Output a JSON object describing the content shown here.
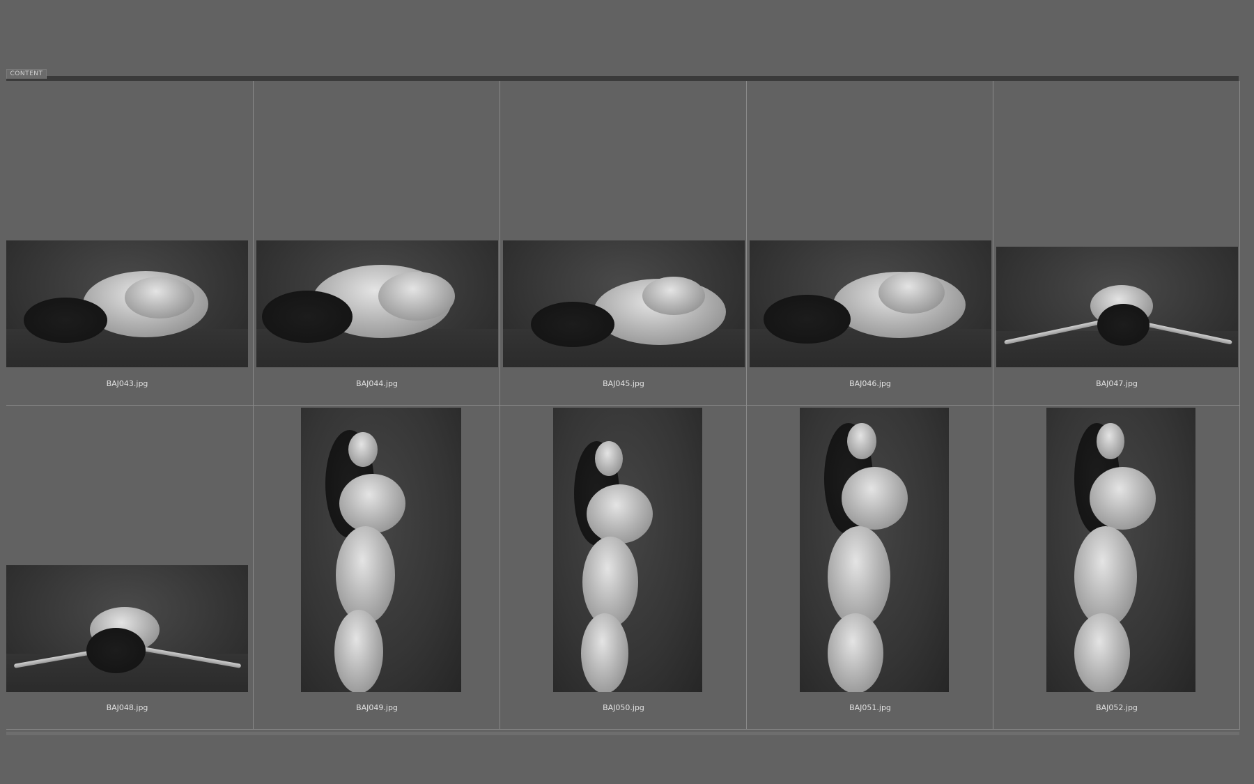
{
  "panel": {
    "tab_label": "CONTENT"
  },
  "thumbnails": [
    {
      "filename": "BAJ043.jpg",
      "orientation": "landscape",
      "pose": "curled-lying"
    },
    {
      "filename": "BAJ044.jpg",
      "orientation": "landscape",
      "pose": "curled-lying"
    },
    {
      "filename": "BAJ045.jpg",
      "orientation": "landscape",
      "pose": "curled-lying"
    },
    {
      "filename": "BAJ046.jpg",
      "orientation": "landscape",
      "pose": "curled-lying"
    },
    {
      "filename": "BAJ047.jpg",
      "orientation": "landscape",
      "pose": "arms-outstretched"
    },
    {
      "filename": "BAJ048.jpg",
      "orientation": "landscape",
      "pose": "arms-outstretched"
    },
    {
      "filename": "BAJ049.jpg",
      "orientation": "portrait",
      "pose": "standing"
    },
    {
      "filename": "BAJ050.jpg",
      "orientation": "portrait",
      "pose": "standing"
    },
    {
      "filename": "BAJ051.jpg",
      "orientation": "portrait",
      "pose": "standing"
    },
    {
      "filename": "BAJ052.jpg",
      "orientation": "portrait",
      "pose": "standing"
    }
  ],
  "colors": {
    "background": "#626262",
    "grid_line": "#8a8a8a",
    "caption_text": "#e2e2e2",
    "top_bar": "#3a3a3a"
  }
}
